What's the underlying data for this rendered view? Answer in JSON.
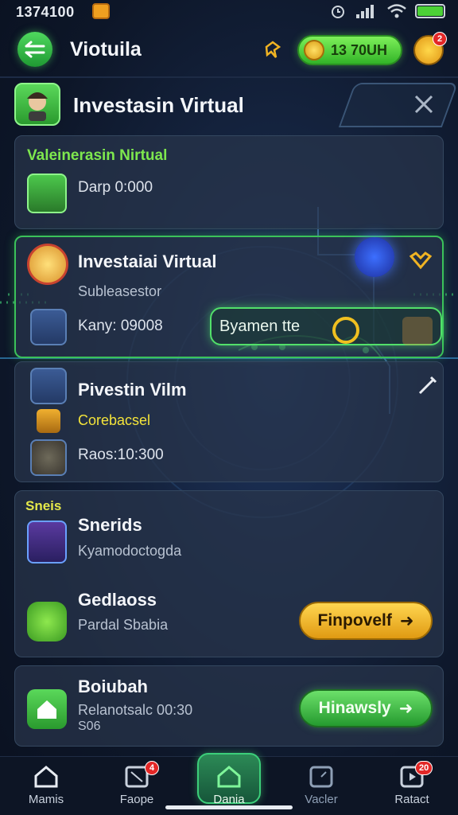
{
  "status_bar": {
    "time": "1374100"
  },
  "header": {
    "title": "Viotuila",
    "coins": "13 70UH",
    "notification_badge": "2"
  },
  "section": {
    "title": "Investasin Virtual"
  },
  "cards": {
    "card1": {
      "label": "Valeinerasin Nirtual",
      "value": "Darp 0:000"
    },
    "card2": {
      "title": "Investaiai Virtual",
      "subtitle": "Subleasestor",
      "value": "Kany: 09008",
      "pill": "Byamen tte"
    },
    "card3": {
      "title": "Pivestin Vilm",
      "subtitle": "Corebacsel",
      "value": "Raos:10:300"
    },
    "card4": {
      "label": "Sneis",
      "item1_title": "Snerids",
      "item1_sub": "Kyamodoctogda",
      "item2_title": "Gedlaoss",
      "item2_sub": "Pardal Sbabia",
      "button": "Finpovelf"
    },
    "card5": {
      "title": "Boiubah",
      "line1": "Relanotsalc 00:30",
      "line2": "S06",
      "button": "Hinawsly"
    }
  },
  "bottom_nav": {
    "items": [
      {
        "label": "Mamis",
        "badge": ""
      },
      {
        "label": "Faope",
        "badge": "4"
      },
      {
        "label": "Dania",
        "badge": ""
      },
      {
        "label": "Vacler",
        "badge": ""
      },
      {
        "label": "Ratact",
        "badge": "20"
      }
    ]
  },
  "colors": {
    "accent_green": "#3bc25a",
    "gold": "#f0b323",
    "background": "#0d1628"
  }
}
